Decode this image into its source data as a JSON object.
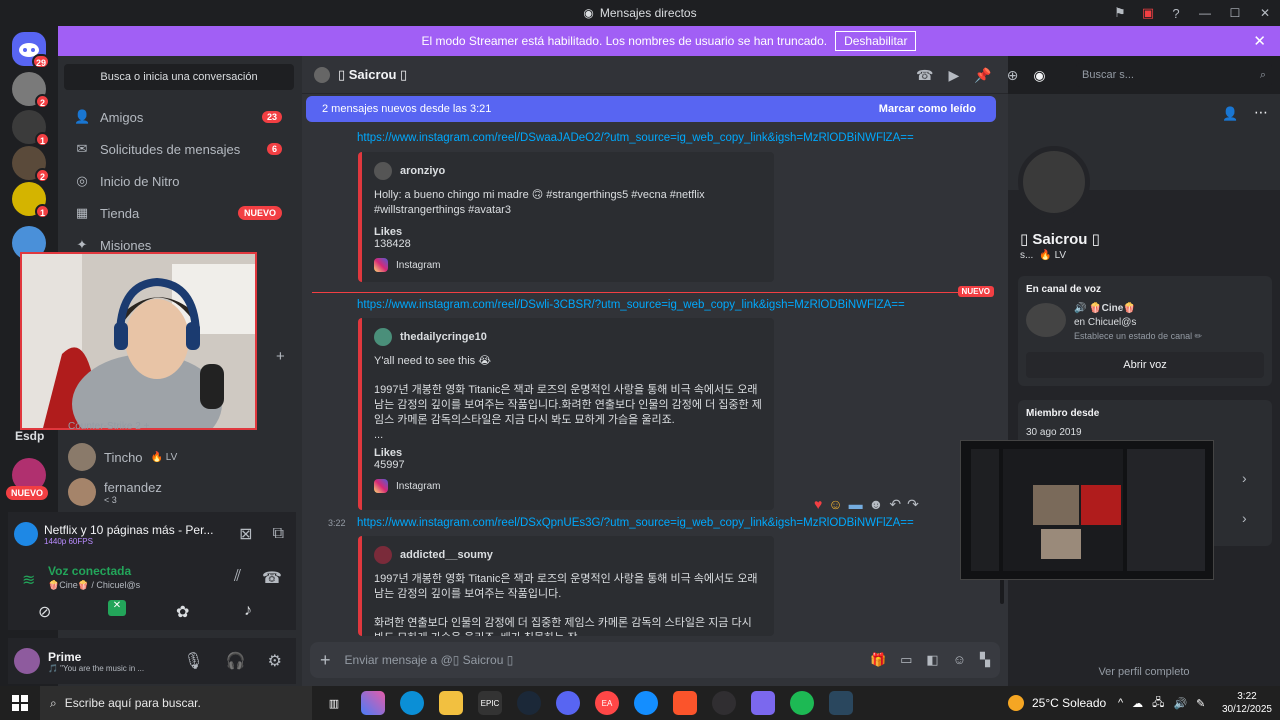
{
  "window": {
    "title": "Mensajes directos"
  },
  "banner": {
    "text": "El modo Streamer está habilitado. Los nombres de usuario se han truncado.",
    "button": "Deshabilitar"
  },
  "rail": {
    "badges": [
      "29",
      "2",
      "1",
      "2",
      "1"
    ],
    "server_label": "Esdp",
    "new_label": "NUEVO"
  },
  "dm": {
    "search": "Busca o inicia una conversación",
    "nav": [
      {
        "label": "Amigos",
        "icon": "friends-icon",
        "count": "23"
      },
      {
        "label": "Solicitudes de mensajes",
        "icon": "mail-icon",
        "count": "6"
      },
      {
        "label": "Inicio de Nitro",
        "icon": "nitro-icon"
      },
      {
        "label": "Tienda",
        "icon": "shop-icon",
        "tag": "NUEVO"
      },
      {
        "label": "Misiones",
        "icon": "quest-icon"
      }
    ],
    "rows": [
      {
        "name": "Counter-Strike 2 +",
        "status": ""
      },
      {
        "name": "Tincho",
        "status": "🔥 LV"
      },
      {
        "name": "fernandez",
        "status": "< 3"
      }
    ]
  },
  "activity": {
    "title": "Netflix y 10 páginas más - Per...",
    "quality": "1440p 60FPS"
  },
  "voice": {
    "status": "Voz conectada",
    "channel": "🍿Cine🍿 / Chicuel@s"
  },
  "user": {
    "name": "Prime",
    "status": "🎵 \"You are the music in ..."
  },
  "chat": {
    "header_name": "▯ Saicrou ▯",
    "search_placeholder": "Buscar s...",
    "newbar_left": "2 mensajes nuevos desde las 3:21",
    "newbar_right": "Marcar como leído",
    "messages": [
      {
        "link": "https://www.instagram.com/reel/DSwaaJADeO2/?utm_source=ig_web_copy_link&igsh=MzRlODBiNWFlZA==",
        "author": "aronziyo",
        "text": "Holly: a bueno chingo mi madre 🙃 #strangerthings5 #vecna #netflix #willstrangerthings #avatar3",
        "field": "Likes",
        "value": "138428",
        "footer": "Instagram"
      },
      {
        "link": "https://www.instagram.com/reel/DSwli-3CBSR/?utm_source=ig_web_copy_link&igsh=MzRlODBiNWFlZA==",
        "author": "thedailycringe10",
        "text1": "Y'all need to see this 😭",
        "text2": "1997년 개봉한 영화 Titanic은 잭과 로즈의 운명적인 사랑을 통해 비극 속에서도 오래 남는 감정의 깊이를 보여주는 작품입니다.화려한 연출보다 인물의 감정에 더 집중한 제임스 카메론 감독의스타일은 지금 다시 봐도 묘하게 가슴을 울리죠.",
        "text3": "...",
        "field": "Likes",
        "value": "45997",
        "footer": "Instagram"
      },
      {
        "time": "3:22",
        "link": "https://www.instagram.com/reel/DSxQpnUEs3G/?utm_source=ig_web_copy_link&igsh=MzRlODBiNWFlZA==",
        "author": "addicted__soumy",
        "text1": "1997년 개봉한 영화 Titanic은 잭과 로즈의 운명적인 사랑을 통해 비극 속에서도 오래 남는 감정의 깊이를 보여주는 작품입니다.",
        "text2": "화려한 연출보다 인물의 감정에 더 집중한 제임스 카메론 감독의 스타일은 지금 다시 봐도 묘하게 가슴을 울리죠. 배가 침몰하는 장"
      }
    ],
    "new_divider": "NUEVO",
    "composer_placeholder": "Enviar mensaje a @▯ Saicrou ▯"
  },
  "profile": {
    "name": "▯ Saicrou ▯",
    "sub": "s...",
    "sub_tag": "🔥 LV",
    "voice_title": "En canal de voz",
    "voice_channel": "🔊 🍿Cine🍿",
    "voice_sub": "en Chicuel@s",
    "voice_status": "Establece un estado de canal ✏",
    "open_voice": "Abrir voz",
    "member_title": "Miembro desde",
    "member_date": "30 ago 2019",
    "view_full": "Ver perfil completo"
  },
  "taskbar": {
    "search": "Escribe aquí para buscar.",
    "weather": "25°C  Soleado",
    "time": "3:22",
    "date": "30/12/2025"
  },
  "colors": {
    "accent": "#a15ff5",
    "blurple": "#5865f2",
    "red": "#f23f43",
    "link": "#00a8fc"
  }
}
